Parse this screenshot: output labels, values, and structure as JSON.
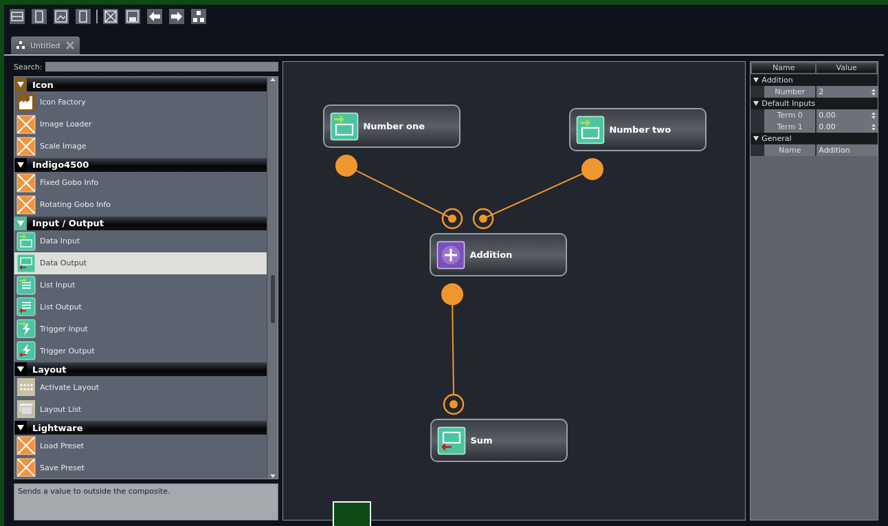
{
  "tabs": [
    {
      "label": "Untitled",
      "selected": true
    }
  ],
  "library": {
    "search": {
      "label": "Search:"
    },
    "categories": [
      {
        "name": "Icon",
        "expanded": true,
        "color": "#8a5a1e",
        "items": [
          {
            "label": "Icon Factory",
            "kind": "factory",
            "selected": false
          },
          {
            "label": "Image Loader",
            "kind": "placeholder",
            "selected": false
          },
          {
            "label": "Scale Image",
            "kind": "placeholder",
            "selected": false
          }
        ]
      },
      {
        "name": "Indigo4500",
        "expanded": true,
        "color": "#000000",
        "items": [
          {
            "label": "Fixed Gobo Info",
            "kind": "placeholder",
            "selected": false
          },
          {
            "label": "Rotating Gobo Info",
            "kind": "placeholder",
            "selected": false
          }
        ]
      },
      {
        "name": "Input / Output",
        "expanded": true,
        "color": "#5fb89a",
        "items": [
          {
            "label": "Data Input",
            "kind": "data-in",
            "selected": false
          },
          {
            "label": "Data Output",
            "kind": "data-out",
            "selected": true
          },
          {
            "label": "List Input",
            "kind": "list-in",
            "selected": false
          },
          {
            "label": "List Output",
            "kind": "list-out",
            "selected": false
          },
          {
            "label": "Trigger Input",
            "kind": "trigger-in",
            "selected": false
          },
          {
            "label": "Trigger Output",
            "kind": "trigger-out",
            "selected": false
          }
        ]
      },
      {
        "name": "Layout",
        "expanded": true,
        "color": "#000000",
        "items": [
          {
            "label": "Activate Layout",
            "kind": "layout",
            "selected": false
          },
          {
            "label": "Layout List",
            "kind": "layout-list",
            "selected": false
          }
        ]
      },
      {
        "name": "Lightware",
        "expanded": true,
        "color": "#000000",
        "items": [
          {
            "label": "Load Preset",
            "kind": "placeholder",
            "selected": false
          },
          {
            "label": "Save Preset",
            "kind": "placeholder",
            "selected": false
          }
        ]
      }
    ],
    "description": "Sends a value to outside the composite."
  },
  "canvas": {
    "nodes": [
      {
        "label": "Number one",
        "kind": "number-in"
      },
      {
        "label": "Number two",
        "kind": "number-in"
      },
      {
        "label": "Addition",
        "kind": "add"
      },
      {
        "label": "Sum",
        "kind": "data-out"
      }
    ]
  },
  "properties": {
    "columns": [
      "Name",
      "Value"
    ],
    "groups": [
      {
        "name": "Addition",
        "expanded": true,
        "rows": [
          {
            "name": "Number",
            "value": "2",
            "kind": "spin"
          }
        ]
      },
      {
        "name": "Default Inputs",
        "expanded": true,
        "rows": [
          {
            "name": "Term 0",
            "value": "0.00",
            "kind": "spin"
          },
          {
            "name": "Term 1",
            "value": "0.00",
            "kind": "spin"
          }
        ]
      },
      {
        "name": "General",
        "expanded": true,
        "rows": [
          {
            "name": "Name",
            "value": "Addition",
            "kind": "text"
          }
        ]
      }
    ]
  }
}
